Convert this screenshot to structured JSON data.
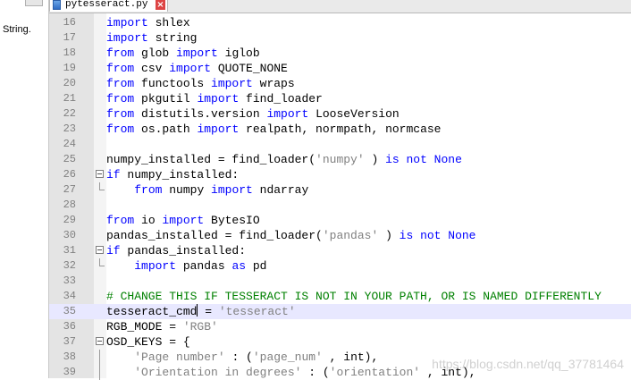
{
  "left_panel": {
    "text": "String."
  },
  "tab": {
    "label": "pytesseract.py",
    "close_glyph": "×"
  },
  "watermark": "https://blog.csdn.net/qq_37781464",
  "colors": {
    "keyword": "#0000ff",
    "string": "#808080",
    "comment": "#008000",
    "current_line": "#e8e8ff"
  },
  "lines": [
    {
      "num": "16",
      "fold": "",
      "segs": [
        [
          "kw2",
          "import"
        ],
        [
          "",
          "shlex"
        ]
      ]
    },
    {
      "num": "17",
      "fold": "",
      "segs": [
        [
          "kw2",
          "import"
        ],
        [
          "",
          "string"
        ]
      ]
    },
    {
      "num": "18",
      "fold": "",
      "segs": [
        [
          "kw2",
          "from"
        ],
        [
          "",
          "glob"
        ],
        [
          "kw2",
          "import"
        ],
        [
          "",
          "iglob"
        ]
      ]
    },
    {
      "num": "19",
      "fold": "",
      "segs": [
        [
          "kw2",
          "from"
        ],
        [
          "",
          "csv"
        ],
        [
          "kw2",
          "import"
        ],
        [
          "",
          "QUOTE_NONE"
        ]
      ]
    },
    {
      "num": "20",
      "fold": "",
      "segs": [
        [
          "kw2",
          "from"
        ],
        [
          "",
          "functools"
        ],
        [
          "kw2",
          "import"
        ],
        [
          "",
          "wraps"
        ]
      ]
    },
    {
      "num": "21",
      "fold": "",
      "segs": [
        [
          "kw2",
          "from"
        ],
        [
          "",
          "pkgutil"
        ],
        [
          "kw2",
          "import"
        ],
        [
          "",
          "find_loader"
        ]
      ]
    },
    {
      "num": "22",
      "fold": "",
      "segs": [
        [
          "kw2",
          "from"
        ],
        [
          "",
          "distutils.version"
        ],
        [
          "kw2",
          "import"
        ],
        [
          "",
          "LooseVersion"
        ]
      ]
    },
    {
      "num": "23",
      "fold": "",
      "segs": [
        [
          "kw2",
          "from"
        ],
        [
          "",
          "os.path"
        ],
        [
          "kw2",
          "import"
        ],
        [
          "",
          "realpath, normpath, normcase"
        ]
      ]
    },
    {
      "num": "24",
      "fold": "",
      "segs": []
    },
    {
      "num": "25",
      "fold": "",
      "segs": [
        [
          "",
          "numpy_installed = find_loader("
        ],
        [
          "str",
          "'numpy'"
        ],
        [
          "",
          ")"
        ],
        [
          "kw2",
          "is not None"
        ]
      ]
    },
    {
      "num": "26",
      "fold": "start",
      "segs": [
        [
          "kw2",
          "if"
        ],
        [
          "",
          "numpy_installed:"
        ]
      ]
    },
    {
      "num": "27",
      "fold": "end",
      "segs": [
        [
          "",
          "    "
        ],
        [
          "kw2",
          "from"
        ],
        [
          "",
          "numpy"
        ],
        [
          "kw2",
          "import"
        ],
        [
          "",
          "ndarray"
        ]
      ]
    },
    {
      "num": "28",
      "fold": "",
      "segs": []
    },
    {
      "num": "29",
      "fold": "",
      "segs": [
        [
          "kw2",
          "from"
        ],
        [
          "",
          "io"
        ],
        [
          "kw2",
          "import"
        ],
        [
          "",
          "BytesIO"
        ]
      ]
    },
    {
      "num": "30",
      "fold": "",
      "segs": [
        [
          "",
          "pandas_installed = find_loader("
        ],
        [
          "str",
          "'pandas'"
        ],
        [
          "",
          ")"
        ],
        [
          "kw2",
          "is not None"
        ]
      ]
    },
    {
      "num": "31",
      "fold": "start",
      "segs": [
        [
          "kw2",
          "if"
        ],
        [
          "",
          "pandas_installed:"
        ]
      ]
    },
    {
      "num": "32",
      "fold": "end",
      "segs": [
        [
          "",
          "    "
        ],
        [
          "kw2",
          "import"
        ],
        [
          "",
          "pandas"
        ],
        [
          "kw2",
          "as"
        ],
        [
          "",
          "pd"
        ]
      ]
    },
    {
      "num": "33",
      "fold": "",
      "segs": []
    },
    {
      "num": "34",
      "fold": "",
      "segs": [
        [
          "cm",
          "# CHANGE THIS IF TESSERACT IS NOT IN YOUR PATH, OR IS NAMED DIFFERENTLY"
        ]
      ]
    },
    {
      "num": "35",
      "fold": "",
      "current": true,
      "segs": [
        [
          "",
          "tesseract_cmd"
        ],
        [
          "caret",
          ""
        ],
        [
          "",
          " = "
        ],
        [
          "str",
          "'tesseract'"
        ]
      ]
    },
    {
      "num": "36",
      "fold": "",
      "segs": [
        [
          "",
          "RGB_MODE = "
        ],
        [
          "str",
          "'RGB'"
        ]
      ]
    },
    {
      "num": "37",
      "fold": "start",
      "segs": [
        [
          "",
          "OSD_KEYS = {"
        ]
      ]
    },
    {
      "num": "38",
      "fold": "mid",
      "segs": [
        [
          "",
          "    "
        ],
        [
          "str",
          "'Page number'"
        ],
        [
          "",
          ": ("
        ],
        [
          "str",
          "'page_num'"
        ],
        [
          "",
          ", int),"
        ]
      ]
    },
    {
      "num": "39",
      "fold": "mid",
      "segs": [
        [
          "",
          "    "
        ],
        [
          "str",
          "'Orientation in degrees'"
        ],
        [
          "",
          ": ("
        ],
        [
          "str",
          "'orientation'"
        ],
        [
          "",
          ", int),"
        ]
      ]
    }
  ]
}
